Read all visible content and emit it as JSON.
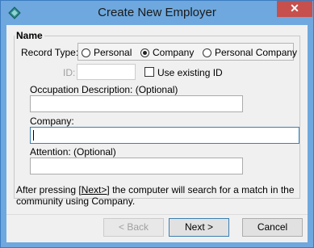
{
  "window": {
    "title": "Create New Employer",
    "close_symbol": "✕"
  },
  "group": {
    "legend": "Name"
  },
  "record_type": {
    "label": "Record Type:",
    "options": [
      "Personal",
      "Company",
      "Personal Company"
    ],
    "selected": "Company"
  },
  "id_field": {
    "label": "ID:",
    "value": ""
  },
  "use_existing_id": {
    "label": "Use existing ID",
    "checked": false
  },
  "occupation": {
    "label": "Occupation Description: (Optional)",
    "value": ""
  },
  "company": {
    "label": "Company:",
    "value": ""
  },
  "attention": {
    "label": "Attention:  (Optional)",
    "value": ""
  },
  "info": {
    "line1_pre": "After pressing ",
    "line1_key": "Next>",
    "line1_post": " the computer will search for a match in the",
    "line2": "community using Company."
  },
  "buttons": {
    "back": "< Back",
    "next": "Next >",
    "cancel": "Cancel"
  },
  "colors": {
    "titlebar": "#6ea8de",
    "close": "#c74f4c",
    "focus_border": "#3c7fb1"
  }
}
